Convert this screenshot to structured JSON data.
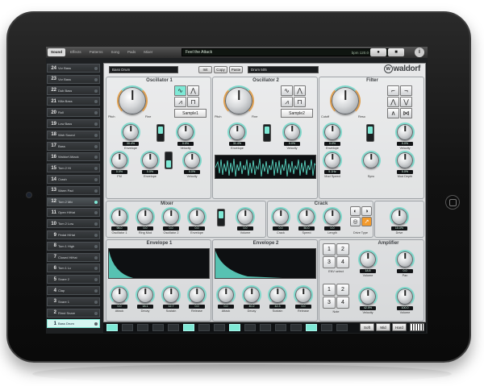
{
  "topbar": {
    "tabs": [
      "Sound",
      "Effects",
      "Patterns",
      "Song",
      "Pads",
      "Mixer"
    ],
    "lcd_title": "Feel the Attack",
    "tempo": "bpm 120.0  ·  ptn 001",
    "info": "i"
  },
  "drum_list": [
    {
      "num": "24",
      "name": "Vcr Bass"
    },
    {
      "num": "23",
      "name": "Vcr Bass"
    },
    {
      "num": "22",
      "name": "Dub Bass"
    },
    {
      "num": "21",
      "name": "Killa Bass"
    },
    {
      "num": "20",
      "name": "Roll"
    },
    {
      "num": "19",
      "name": "Low Bass"
    },
    {
      "num": "18",
      "name": "Wah Sound"
    },
    {
      "num": "17",
      "name": "Bass"
    },
    {
      "num": "16",
      "name": "Waldorf Attack"
    },
    {
      "num": "15",
      "name": "Tom 2 Hi"
    },
    {
      "num": "14",
      "name": "Crash"
    },
    {
      "num": "13",
      "name": "Warm Pad"
    },
    {
      "num": "12",
      "name": "Tom 2 Mid"
    },
    {
      "num": "11",
      "name": "Open HiHat"
    },
    {
      "num": "10",
      "name": "Tom 2 Low"
    },
    {
      "num": "9",
      "name": "Pedal HiHat"
    },
    {
      "num": "8",
      "name": "Tom 1 High"
    },
    {
      "num": "7",
      "name": "Closed HiHat"
    },
    {
      "num": "6",
      "name": "Tom 1 Lo"
    },
    {
      "num": "5",
      "name": "Snare 2"
    },
    {
      "num": "4",
      "name": "Clap"
    },
    {
      "num": "3",
      "name": "Snare 1"
    },
    {
      "num": "2",
      "name": "Rimd Snare"
    },
    {
      "num": "1",
      "name": "Bass Drum"
    }
  ],
  "panel": {
    "instrument_name": "Bass Drum",
    "init_label": "Init",
    "copy_label": "Copy",
    "paste_label": "Paste",
    "preset_field": "Drum 505",
    "logo": "waldorf",
    "logo_mark": "w"
  },
  "osc1": {
    "title": "Oscillator 1",
    "sample": "Sample1",
    "pitch_label": "Pitch",
    "fine_label": "Fine",
    "envelope_label": "Envelope",
    "velocity_label": "Velocity",
    "fm_label": "FM",
    "velocity2_label": "Velocity",
    "env_val": "30.4%",
    "vel_val": "0.0%",
    "fm_val": "0.0%",
    "env2_val": "0.0%",
    "vel2_val": "0.0%"
  },
  "osc2": {
    "title": "Oscillator 2",
    "sample": "Sample2",
    "pitch_label": "Pitch",
    "fine_label": "Fine",
    "envelope_label": "Envelope",
    "velocity_label": "Velocity",
    "env_val": "31.4%",
    "vel_val": "0.0%"
  },
  "filter": {
    "title": "Filter",
    "cutoff_label": "Cutoff",
    "reso_label": "Reso",
    "envelope_label": "Envelope",
    "velocity_label": "Velocity",
    "mod_speed_label": "Mod Speed",
    "sync_label": "Sync",
    "mod_depth_label": "Mod Depth",
    "env_val": "0.0%",
    "vel_val": "0.0%",
    "mod_speed_val": "5.1Hz",
    "mod_depth_val": "0.0%"
  },
  "mixer": {
    "title": "Mixer",
    "labels": [
      "Oscillator 1",
      "Ring Mod",
      "Oscillator 2",
      "Envelope"
    ],
    "values": [
      "98.0",
      "0.0",
      "0.0",
      "0.0"
    ]
  },
  "crack": {
    "title": "Crack",
    "labels": [
      "Volume",
      "Crack",
      "Speed",
      "Length"
    ],
    "values": [
      "0.0",
      "0.0",
      "50.0",
      "0.0"
    ]
  },
  "drive": {
    "drive_type_label": "Drive Type",
    "drive_label": "Drive",
    "drive_val": "10.0%"
  },
  "env1": {
    "title": "Envelope 1",
    "labels": [
      "Attack",
      "Decay",
      "Sustain",
      "Release"
    ],
    "values": [
      "0.0",
      "18.1",
      "12.7",
      "0.0"
    ]
  },
  "env2": {
    "title": "Envelope 2",
    "labels": [
      "Attack",
      "Decay",
      "Sustain",
      "Release"
    ],
    "values": [
      "0.0",
      "40.2",
      "42.3",
      "0.0"
    ]
  },
  "amp": {
    "title": "Amplifier",
    "labels": [
      "Volume",
      "Pan",
      "Velocity",
      "Volume"
    ],
    "values": [
      "18.8",
      "0.0",
      "42.5%",
      "100.0"
    ],
    "env_select_label": "ENV select",
    "nums": [
      "1",
      "2",
      "3",
      "4"
    ],
    "nums2": [
      "1",
      "2",
      "3",
      "4"
    ],
    "note_label": "Note"
  },
  "bottombar": {
    "soft": "Soft",
    "mid": "Mid",
    "hard": "Hard",
    "steps_on": [
      1,
      0,
      0,
      0,
      0,
      1,
      0,
      0,
      1,
      0,
      0,
      0,
      0,
      1,
      0,
      0
    ]
  }
}
